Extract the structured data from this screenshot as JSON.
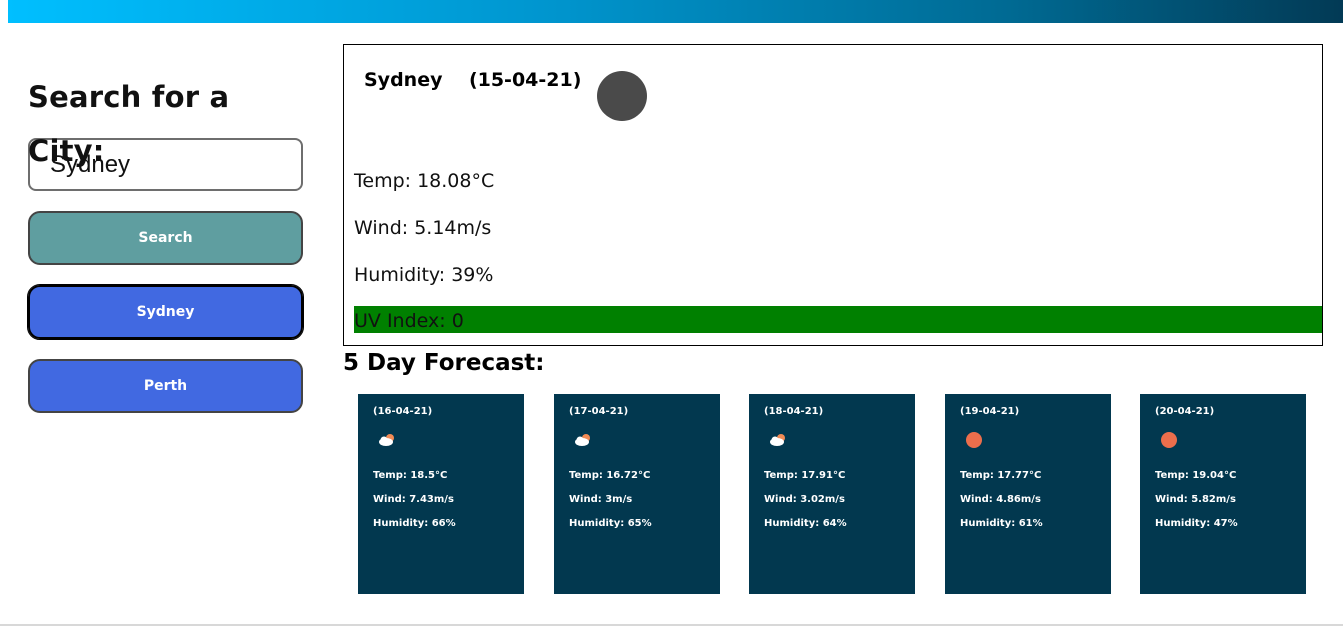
{
  "search": {
    "heading": "Search for a City:",
    "input_value": "Sydney",
    "button_label": "Search"
  },
  "history": [
    {
      "label": "Sydney",
      "active": true
    },
    {
      "label": "Perth",
      "active": false
    }
  ],
  "current": {
    "city": "Sydney",
    "date": "(15-04-21)",
    "icon": "dark-circle-icon",
    "temp": "Temp: 18.08°C",
    "wind": "Wind: 5.14m/s",
    "humidity": "Humidity: 39%",
    "uv": "UV Index: 0",
    "uv_color": "#008000"
  },
  "forecast": {
    "title": "5 Day Forecast:",
    "days": [
      {
        "date": "(16-04-21)",
        "icon": "partly-cloudy-icon",
        "temp": "Temp: 18.5°C",
        "wind": "Wind: 7.43m/s",
        "humidity": "Humidity: 66%"
      },
      {
        "date": "(17-04-21)",
        "icon": "partly-cloudy-icon",
        "temp": "Temp: 16.72°C",
        "wind": "Wind: 3m/s",
        "humidity": "Humidity: 65%"
      },
      {
        "date": "(18-04-21)",
        "icon": "partly-cloudy-icon",
        "temp": "Temp: 17.91°C",
        "wind": "Wind: 3.02m/s",
        "humidity": "Humidity: 64%"
      },
      {
        "date": "(19-04-21)",
        "icon": "sun-icon",
        "temp": "Temp: 17.77°C",
        "wind": "Wind: 4.86m/s",
        "humidity": "Humidity: 61%"
      },
      {
        "date": "(20-04-21)",
        "icon": "sun-icon",
        "temp": "Temp: 19.04°C",
        "wind": "Wind: 5.82m/s",
        "humidity": "Humidity: 47%"
      }
    ]
  },
  "colors": {
    "header_gradient_start": "#00bfff",
    "header_gradient_end": "#023a55",
    "search_button": "#5f9ea0",
    "history_button": "#4169e1",
    "card_bg": "#02384f"
  }
}
